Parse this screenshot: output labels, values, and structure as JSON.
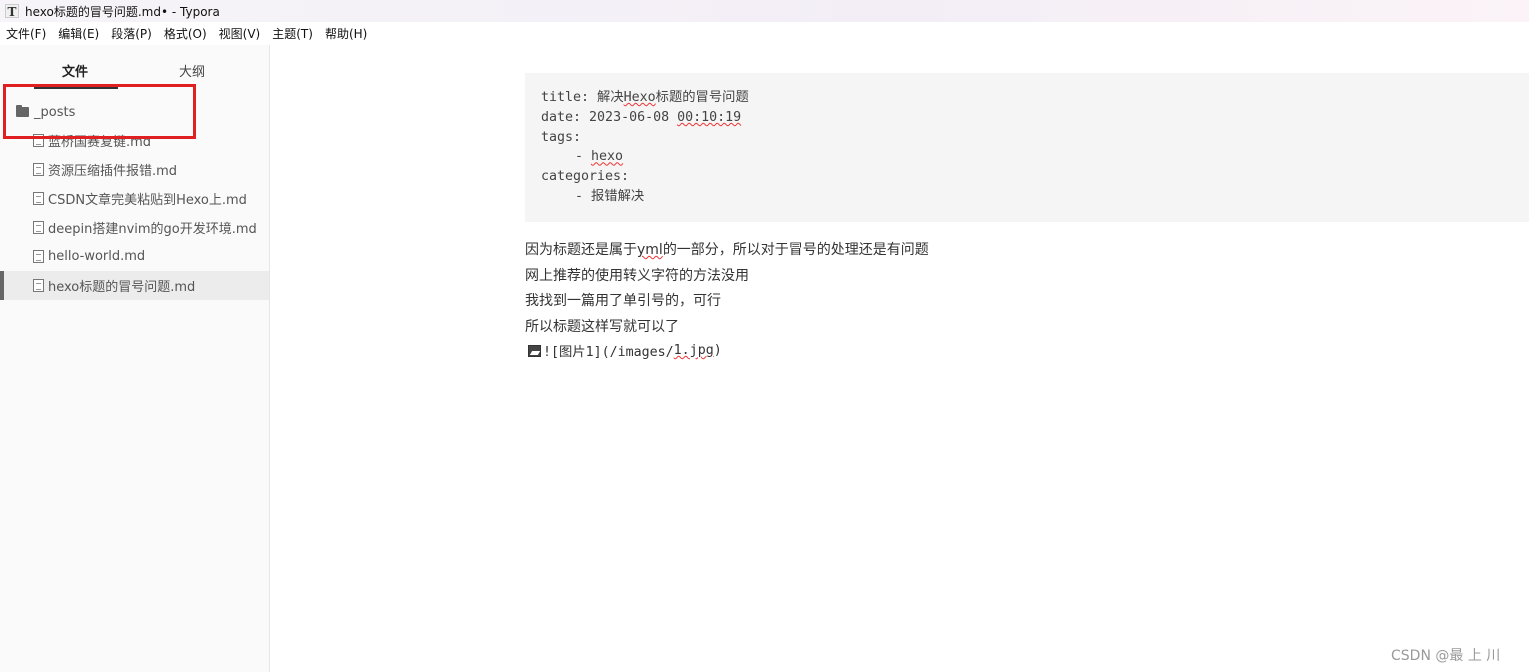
{
  "window": {
    "app_icon": "T",
    "title": "hexo标题的冒号问题.md• - Typora"
  },
  "menubar": {
    "items": [
      "文件(F)",
      "编辑(E)",
      "段落(P)",
      "格式(O)",
      "视图(V)",
      "主题(T)",
      "帮助(H)"
    ]
  },
  "sidebar": {
    "tabs": {
      "files": "文件",
      "outline": "大纲"
    },
    "folder": {
      "label": "_posts",
      "icon": "folder-icon"
    },
    "files": [
      {
        "label": "蓝桥国赛复键.md"
      },
      {
        "label": "资源压缩插件报错.md"
      },
      {
        "label": "CSDN文章完美粘贴到Hexo上.md"
      },
      {
        "label": "deepin搭建nvim的go开发环境.md"
      },
      {
        "label": "hello-world.md"
      },
      {
        "label": "hexo标题的冒号问题.md",
        "active": true
      }
    ]
  },
  "highlight_color": "#e02020",
  "editor": {
    "frontmatter": {
      "title_key": "title: ",
      "title_pre": "解决",
      "title_word": "Hexo",
      "title_post": "标题的冒号问题",
      "date_key": "date: ",
      "date_day": "2023-06-08 ",
      "date_time": "00:10:19",
      "tags_key": "tags:",
      "tags_dash": "- ",
      "tag_value": "hexo",
      "categories_key": "categories:",
      "category_dash": "- ",
      "category_value": "报错解决"
    },
    "paragraphs": {
      "p1_pre": "因为标题还是属于",
      "p1_word": "yml",
      "p1_post": "的一部分，所以对于冒号的处理还是有问题",
      "p2": "网上推荐的使用转义字符的方法没用",
      "p3": "我找到一篇用了单引号的，可行",
      "p4": "所以标题这样写就可以了"
    },
    "image": {
      "icon": "broken-image-icon",
      "md_pre": "![图片1](/images/",
      "md_file": "1.jpg",
      "md_post": ")"
    }
  },
  "watermark": "CSDN @最 上 川"
}
